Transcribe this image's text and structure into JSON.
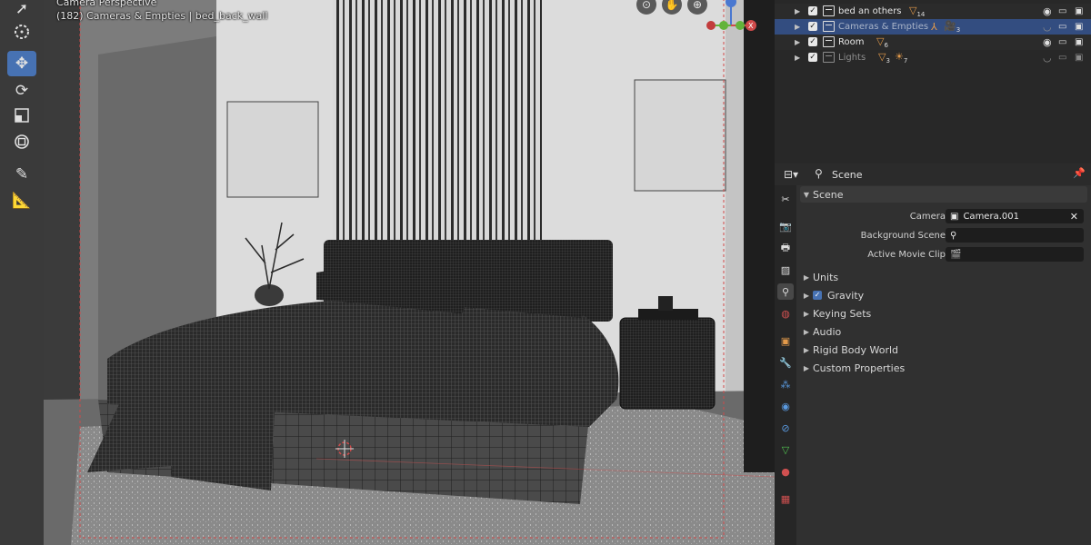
{
  "viewport": {
    "view_name": "Camera Perspective",
    "view_info": "(182) Cameras & Empties | bed_back_wall"
  },
  "toolbar": {
    "tools": [
      {
        "name": "select",
        "icon": "cursor-icon"
      },
      {
        "name": "cursor",
        "icon": "3d-cursor-icon"
      },
      {
        "name": "move",
        "icon": "move-icon",
        "active": true
      },
      {
        "name": "rotate",
        "icon": "rotate-icon"
      },
      {
        "name": "scale",
        "icon": "scale-icon"
      },
      {
        "name": "transform",
        "icon": "transform-icon"
      },
      {
        "name": "annotate",
        "icon": "annotate-icon"
      },
      {
        "name": "measure",
        "icon": "measure-icon"
      }
    ]
  },
  "outliner": {
    "rows": [
      {
        "name": "bed an others",
        "badge_count": "14",
        "selected": false,
        "visible": true
      },
      {
        "name": "Cameras & Empties",
        "badge_count": "3",
        "selected": true,
        "visible": false
      },
      {
        "name": "Room",
        "badge_count": "6",
        "selected": false,
        "visible": true
      },
      {
        "name": "Lights",
        "badge_count": "3",
        "badge_count2": "7",
        "selected": false,
        "visible": false
      }
    ]
  },
  "properties": {
    "context_label": "Scene",
    "section_title": "Scene",
    "camera_label": "Camera",
    "camera_value": "Camera.001",
    "background_scene_label": "Background Scene",
    "background_scene_value": "",
    "movie_clip_label": "Active Movie Clip",
    "movie_clip_value": "",
    "subpanels": {
      "units": "Units",
      "gravity": "Gravity",
      "keying_sets": "Keying Sets",
      "audio": "Audio",
      "rigid_body_world": "Rigid Body World",
      "custom_properties": "Custom Properties"
    },
    "gravity_enabled": true
  },
  "colors": {
    "accent": "#4772b3",
    "selection_row": "#334d80",
    "camera_frame": "#d04a4a"
  }
}
